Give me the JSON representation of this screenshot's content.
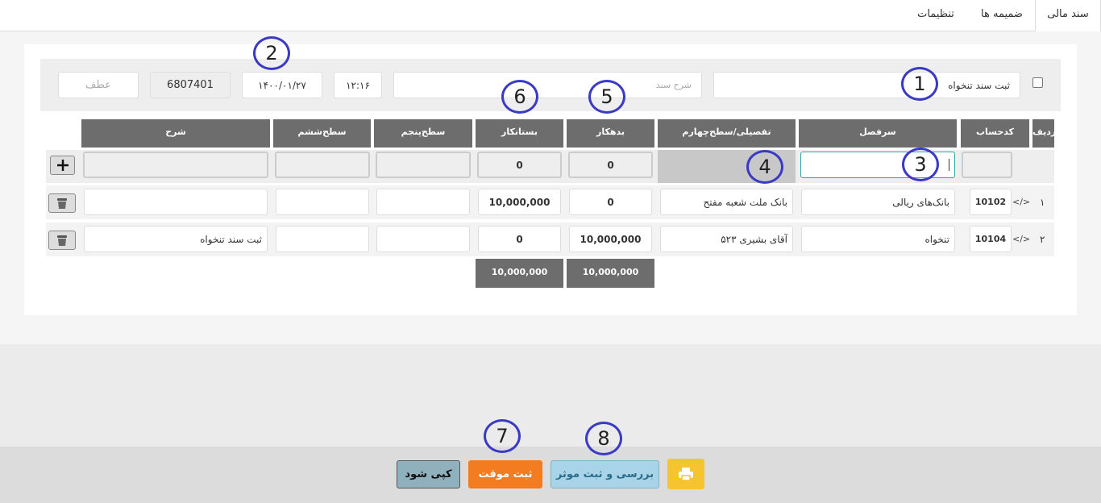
{
  "tabs": [
    {
      "label": "سند مالی",
      "active": true
    },
    {
      "label": "ضمیمه ها",
      "active": false
    },
    {
      "label": "تنظیمات",
      "active": false
    }
  ],
  "header": {
    "description_value": "ثبت سند تنخواه",
    "doc_description_placeholder": "شرح سند",
    "time": "۱۲:۱۶",
    "date": "۱۴۰۰/۰۱/۲۷",
    "doc_number": "6807401",
    "reference_placeholder": "عطف"
  },
  "table": {
    "columns": {
      "row": "ردیف",
      "account_code": "کدحساب",
      "ledger": "سرفصل",
      "detail": "تفصیلی/سطح‌چهارم",
      "debit": "بدهکار",
      "credit": "بستانکار",
      "level5": "سطح‌پنجم",
      "level6": "سطح‌ششم",
      "description": "شرح"
    },
    "new_row": {
      "debit": "0",
      "credit": "0"
    },
    "rows": [
      {
        "num": "۱",
        "code": "10102",
        "ledger": "بانک‌های ریالی",
        "detail": "بانک ملت شعبه مفتح",
        "debit": "0",
        "credit": "10,000,000",
        "level5": "",
        "level6": "",
        "description": ""
      },
      {
        "num": "۲",
        "code": "10104",
        "ledger": "تنخواه",
        "detail": "آقای بشیری ۵۲۳",
        "debit": "10,000,000",
        "credit": "0",
        "level5": "",
        "level6": "",
        "description": "ثبت سند تنخواه"
      }
    ],
    "totals": {
      "debit": "10,000,000",
      "credit": "10,000,000"
    }
  },
  "footer": {
    "copy_label": "کپی شود",
    "temp_save_label": "ثبت موقت",
    "review_save_label": "بررسی و ثبت موثر"
  },
  "markers": [
    "1",
    "2",
    "3",
    "4",
    "5",
    "6",
    "7",
    "8"
  ],
  "colors": {
    "header_gray": "#6d6d6d",
    "temp_save": "#f47c20",
    "review": "#a9d3e6",
    "print": "#f6c431",
    "copy": "#8fb1bd",
    "marker": "#3a3ac4"
  }
}
